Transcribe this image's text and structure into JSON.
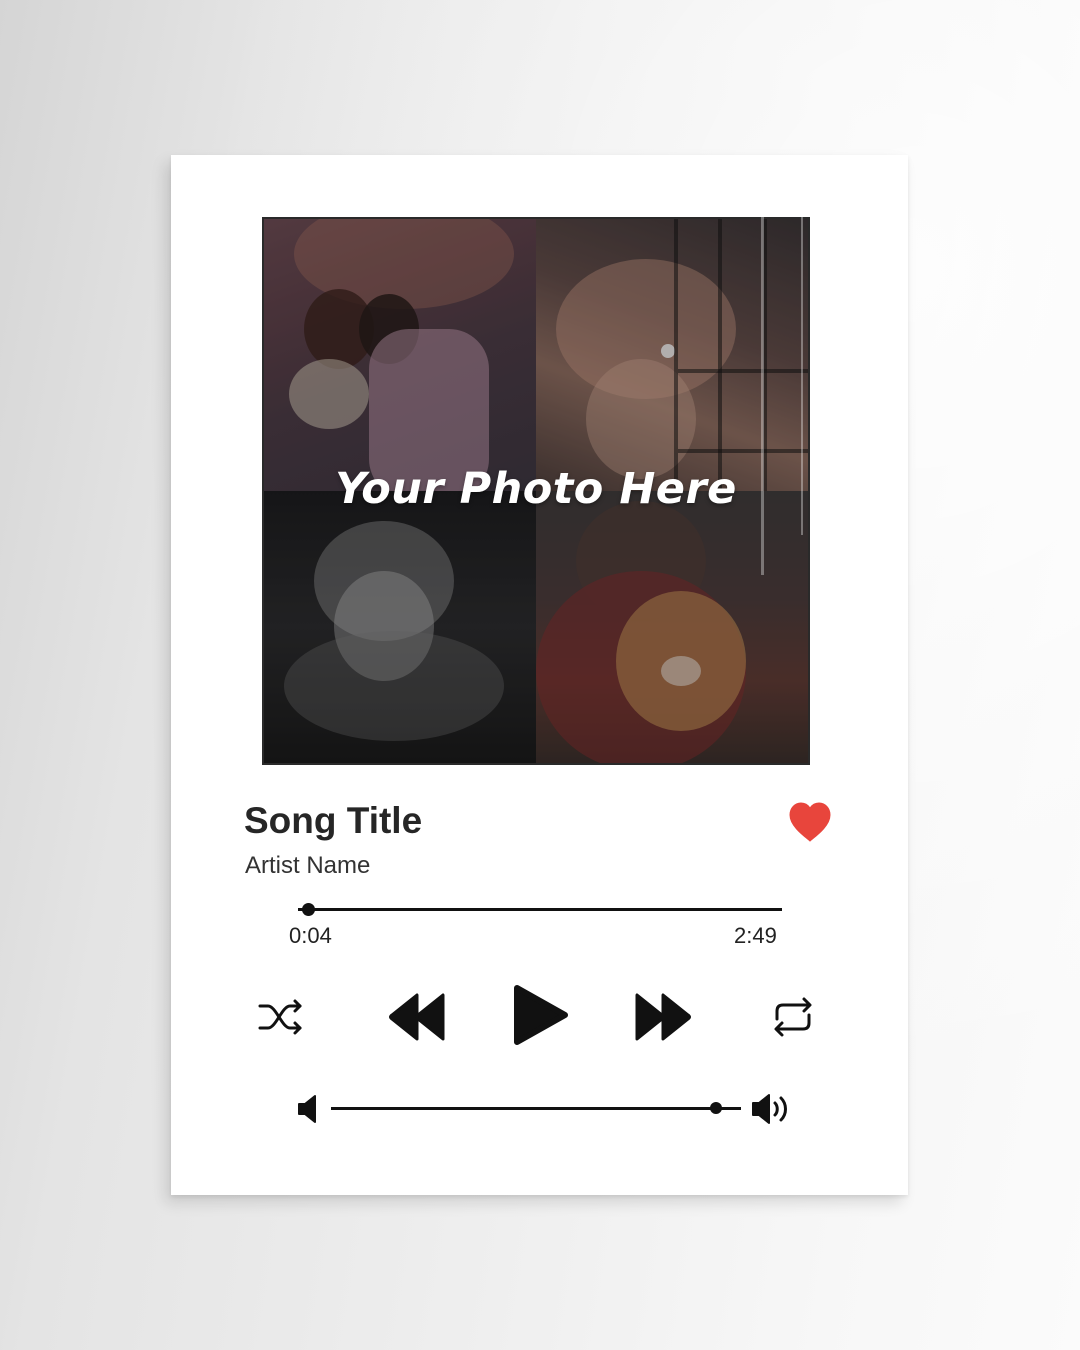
{
  "photo": {
    "label": "Your Photo Here"
  },
  "track": {
    "title": "Song Title",
    "artist": "Artist Name",
    "liked": true
  },
  "playback": {
    "current_time": "0:04",
    "total_time": "2:49",
    "progress_fraction": 0.02,
    "volume_fraction": 0.94
  },
  "icons": {
    "shuffle": "shuffle-icon",
    "previous": "rewind-icon",
    "play": "play-icon",
    "next": "fast-forward-icon",
    "repeat": "repeat-icon",
    "volume_low": "volume-low-icon",
    "volume_high": "volume-high-icon",
    "like": "heart-icon"
  },
  "colors": {
    "heart": "#e8453c",
    "controls": "#111111",
    "card": "#ffffff"
  }
}
